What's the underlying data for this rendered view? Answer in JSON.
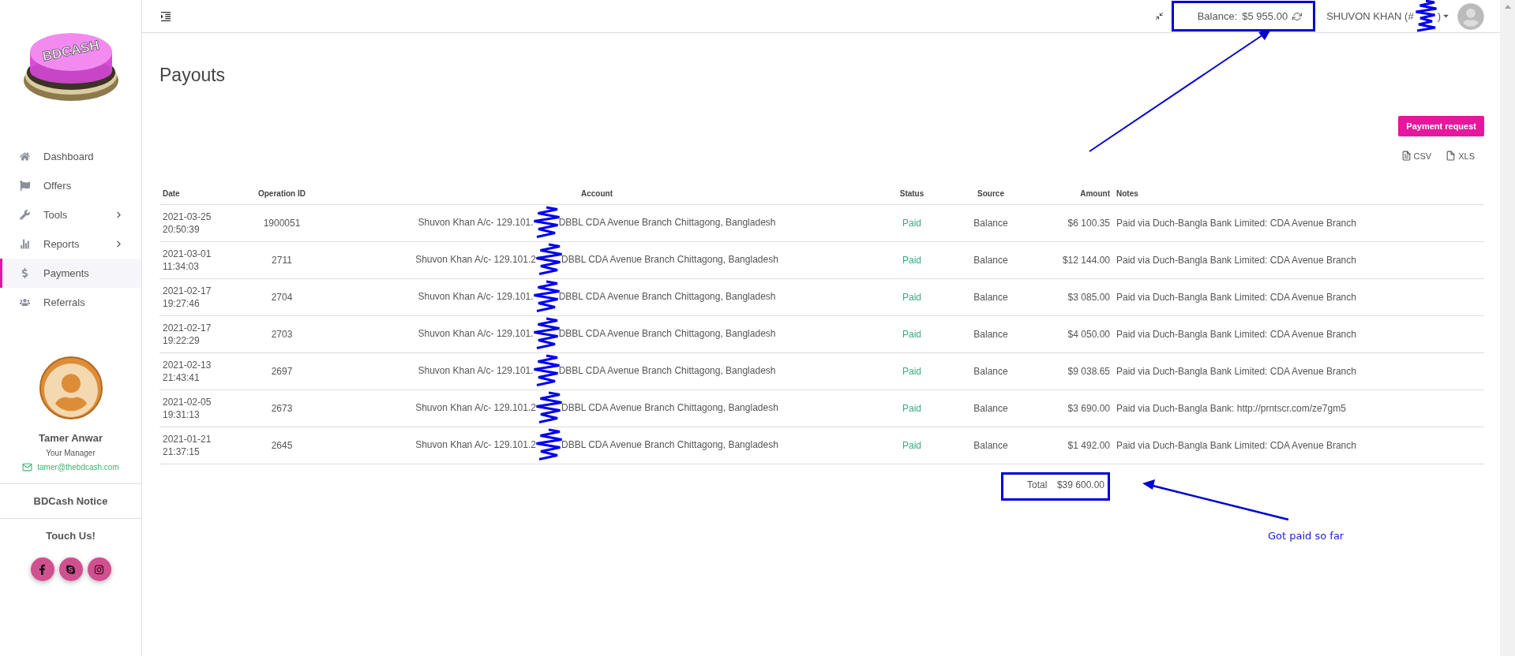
{
  "sidebar": {
    "logo_text": "BDCASH",
    "nav": [
      {
        "label": "Dashboard",
        "selected": false,
        "submenu": false
      },
      {
        "label": "Offers",
        "selected": false,
        "submenu": false
      },
      {
        "label": "Tools",
        "selected": false,
        "submenu": true
      },
      {
        "label": "Reports",
        "selected": false,
        "submenu": true
      },
      {
        "label": "Payments",
        "selected": true,
        "submenu": false
      },
      {
        "label": "Referrals",
        "selected": false,
        "submenu": false
      }
    ],
    "manager": {
      "name": "Tamer Anwar",
      "role": "Your Manager",
      "email": "tamer@thebdcash.com"
    },
    "notice_title": "BDCash Notice",
    "contact_title": "Touch Us!",
    "social": [
      {
        "kind": "facebook"
      },
      {
        "kind": "skype"
      },
      {
        "kind": "instagram"
      }
    ]
  },
  "topbar": {
    "balance_label": "Balance:",
    "balance_value": "$5 955.00",
    "user_name": "SHUVON KHAN (#",
    "user_name_end": ")"
  },
  "page": {
    "title": "Payouts",
    "payment_button": "Payment request",
    "exports": [
      {
        "kind": "csv",
        "label": "CSV"
      },
      {
        "kind": "xls",
        "label": "XLS"
      }
    ]
  },
  "table": {
    "columns": [
      "Date",
      "Operation ID",
      "Account",
      "Status",
      "Source",
      "Amount",
      "Notes"
    ],
    "rows": [
      {
        "date": "2021-03-25 20:50:39",
        "operation_id": "1900051",
        "account": "Shuvon Khan A/c- 129.101.",
        "account_end": "DBBL CDA Avenue Branch Chittagong, Bangladesh",
        "status": "Paid",
        "source": "Balance",
        "amount": "$6 100.35",
        "notes": "Paid via Duch-Bangla Bank Limited: CDA Avenue Branch"
      },
      {
        "date": "2021-03-01 11:34:03",
        "operation_id": "2711",
        "account": "Shuvon Khan A/c- 129.101.2",
        "account_end": "DBBL CDA Avenue Branch Chittagong, Bangladesh",
        "status": "Paid",
        "source": "Balance",
        "amount": "$12 144.00",
        "notes": "Paid via Duch-Bangla Bank Limited: CDA Avenue Branch"
      },
      {
        "date": "2021-02-17 19:27:46",
        "operation_id": "2704",
        "account": "Shuvon Khan A/c- 129.101.",
        "account_end": "DBBL CDA Avenue Branch Chittagong, Bangladesh",
        "status": "Paid",
        "source": "Balance",
        "amount": "$3 085.00",
        "notes": "Paid via Duch-Bangla Bank Limited: CDA Avenue Branch"
      },
      {
        "date": "2021-02-17 19:22:29",
        "operation_id": "2703",
        "account": "Shuvon Khan A/c- 129.101.",
        "account_end": "DBBL CDA Avenue Branch Chittagong, Bangladesh",
        "status": "Paid",
        "source": "Balance",
        "amount": "$4 050.00",
        "notes": "Paid via Duch-Bangla Bank Limited: CDA Avenue Branch"
      },
      {
        "date": "2021-02-13 21:43:41",
        "operation_id": "2697",
        "account": "Shuvon Khan A/c- 129.101.",
        "account_end": "DBBL CDA Avenue Branch Chittagong, Bangladesh",
        "status": "Paid",
        "source": "Balance",
        "amount": "$9 038.65",
        "notes": "Paid via Duch-Bangla Bank Limited: CDA Avenue Branch"
      },
      {
        "date": "2021-02-05 19:31:13",
        "operation_id": "2673",
        "account": "Shuvon Khan A/c- 129.101.2",
        "account_end": "DBBL CDA Avenue Branch Chittagong, Bangladesh",
        "status": "Paid",
        "source": "Balance",
        "amount": "$3 690.00",
        "notes": "Paid via Duch-Bangla Bank: http://prntscr.com/ze7gm5"
      },
      {
        "date": "2021-01-21 21:37:15",
        "operation_id": "2645",
        "account": "Shuvon Khan A/c- 129.101.2",
        "account_end": "DBBL CDA Avenue Branch Chittagong, Bangladesh",
        "status": "Paid",
        "source": "Balance",
        "amount": "$1 492.00",
        "notes": "Paid via Duch-Bangla Bank Limited: CDA Avenue Branch"
      }
    ],
    "total_label": "Total",
    "total_value": "$39 600.00"
  },
  "annotation": {
    "note": "Got paid so far"
  }
}
